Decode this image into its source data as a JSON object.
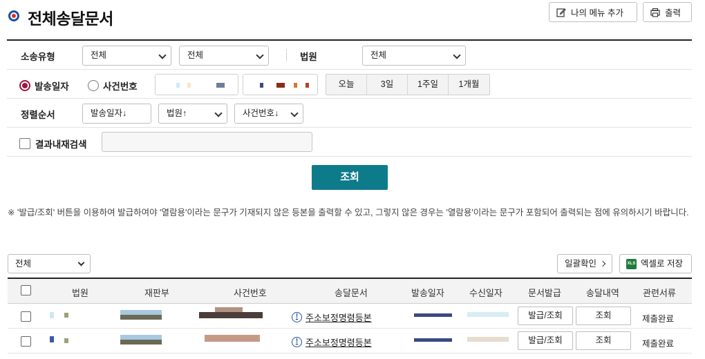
{
  "header": {
    "title": "전체송달문서",
    "my_menu_label": "나의 메뉴 추가",
    "print_label": "출력"
  },
  "form": {
    "litigation_type_label": "소송유형",
    "litigation_type_1": "전체",
    "litigation_type_2": "전체",
    "court_label": "법원",
    "court_value": "전체",
    "radio_send_date": "발송일자",
    "radio_case_number": "사건번호",
    "period_buttons": [
      "오늘",
      "3일",
      "1주일",
      "1개월"
    ],
    "sort_label": "정렬순서",
    "sort_1": "발송일자↓",
    "sort_2": "법원↑",
    "sort_3": "사건번호↓",
    "result_search_label": "결과내재검색",
    "result_search_value": "",
    "search_button": "조회"
  },
  "notice": "※ '발급/조회' 버튼을 이용하여 발급하여야 '열람용'이라는 문구가 기재되지 않은 등본을 출력할 수 있고, 그렇지 않은 경우는 '열람용'이라는 문구가 포함되어 출력되는 점에 유의하시기 바랍니다.",
  "list": {
    "filter_value": "전체",
    "batch_confirm_label": "일괄확인",
    "excel_label": "엑셀로 저장",
    "excel_icon_text": "XLS",
    "columns": [
      "법원",
      "재판부",
      "사건번호",
      "송달문서",
      "발송일자",
      "수신일자",
      "문서발급",
      "송달내역",
      "관련서류"
    ],
    "rows": [
      {
        "document": "주소보정명령등본",
        "issue_label": "발급/조회",
        "view_label": "조회",
        "related": "제출완료"
      },
      {
        "document": "주소보정명령등본",
        "issue_label": "발급/조회",
        "view_label": "조회",
        "related": "제출완료"
      }
    ]
  },
  "colors": {
    "accent_teal": "#0d7b8a",
    "radio_selected": "#a11541",
    "info_icon_blue": "#1f4fa3"
  }
}
